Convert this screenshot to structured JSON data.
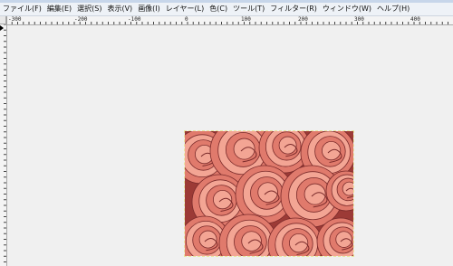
{
  "menubar": {
    "items": [
      "ファイル(F)",
      "編集(E)",
      "選択(S)",
      "表示(V)",
      "画像(I)",
      "レイヤー(L)",
      "色(C)",
      "ツール(T)",
      "フィルター(R)",
      "ウィンドウ(W)",
      "ヘルプ(H)"
    ]
  },
  "ruler": {
    "top_labels": [
      "-300",
      "-200",
      "-100",
      "0",
      "100",
      "200",
      "300",
      "400"
    ]
  },
  "image": {
    "icon": "rose-photo",
    "colors": {
      "base": "#b84a45",
      "petal": "#e07a6c",
      "highlight": "#f3a594",
      "shadow": "#7a2a2a"
    }
  }
}
